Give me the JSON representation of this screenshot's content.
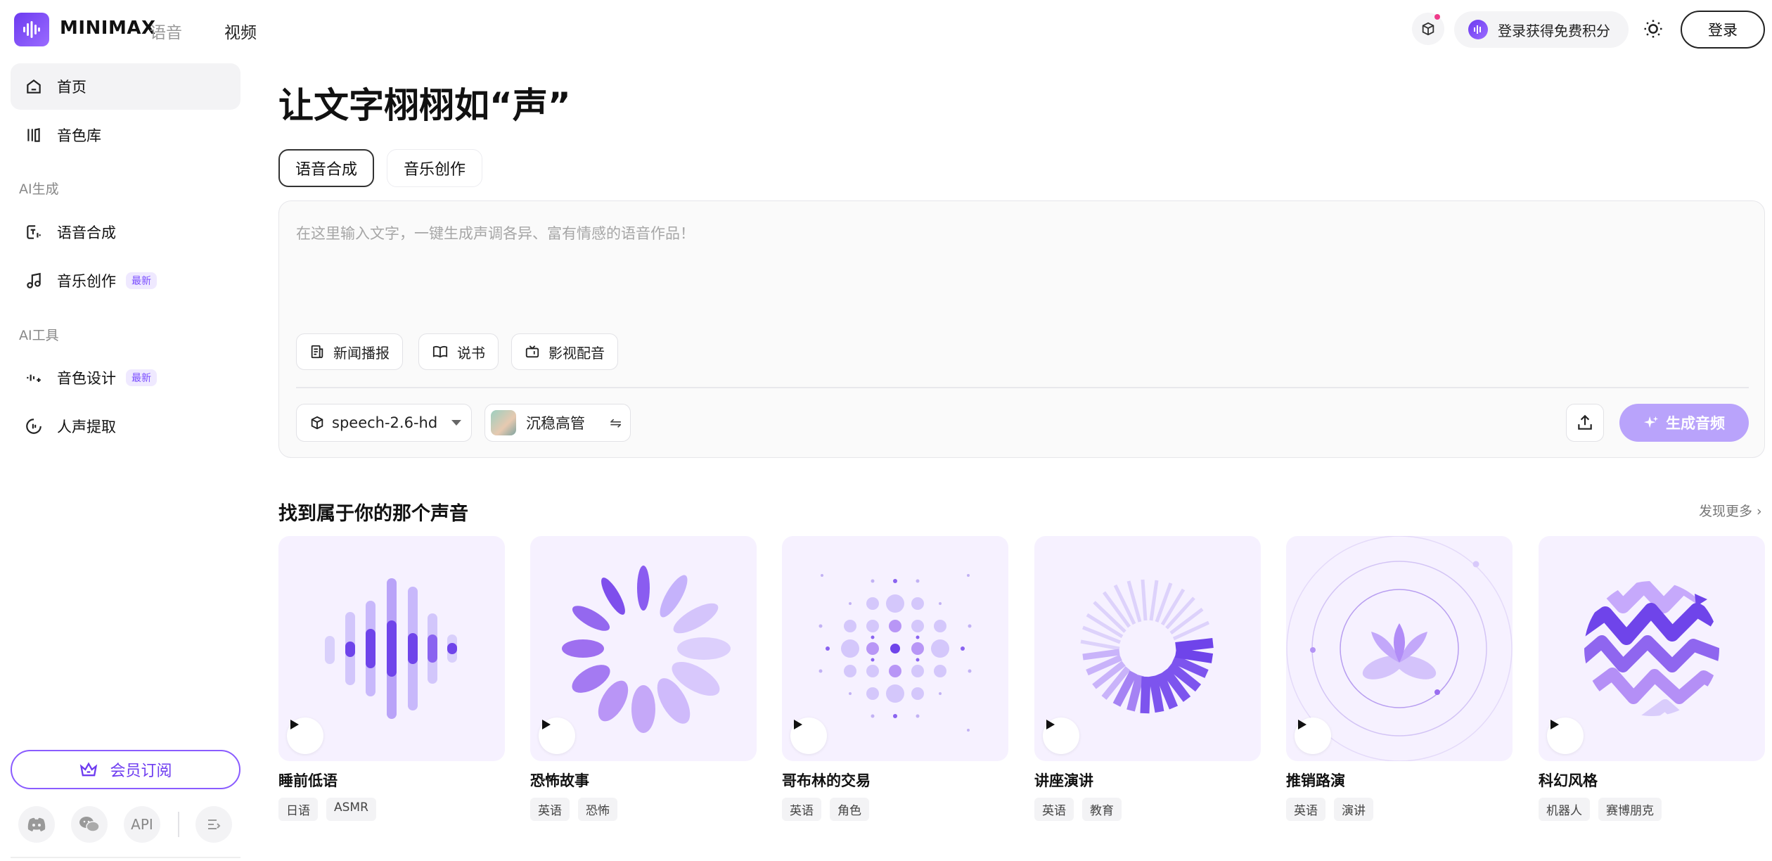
{
  "header": {
    "logo_text": "MINIMAX",
    "nav_voice": "语音",
    "nav_video": "视频",
    "points_label": "登录获得免费积分",
    "login_label": "登录"
  },
  "sidebar": {
    "items": [
      {
        "label": "首页",
        "icon": "home-icon"
      },
      {
        "label": "音色库",
        "icon": "library-icon"
      },
      {
        "label": "语音合成",
        "icon": "tts-icon"
      },
      {
        "label": "音乐创作",
        "icon": "music-note-icon",
        "badge": "最新"
      },
      {
        "label": "音色设计",
        "icon": "voice-design-icon",
        "badge": "最新"
      },
      {
        "label": "人声提取",
        "icon": "vocal-extract-icon"
      }
    ],
    "section_generate": "AI生成",
    "section_tools": "AI工具",
    "vip_label": "会员订阅",
    "footer": {
      "api_label": "API"
    }
  },
  "main": {
    "title": "让文字栩栩如“声”",
    "tabs": [
      {
        "label": "语音合成"
      },
      {
        "label": "音乐创作"
      }
    ],
    "editor": {
      "placeholder": "在这里输入文字，一键生成声调各异、富有情感的语音作品！",
      "chips": [
        {
          "label": "新闻播报",
          "icon": "news-icon"
        },
        {
          "label": "说书",
          "icon": "book-icon"
        },
        {
          "label": "影视配音",
          "icon": "tv-icon"
        }
      ],
      "model": "speech-2.6-hd",
      "voice": "沉稳高管",
      "generate_label": "生成音频"
    },
    "section_title": "找到属于你的那个声音",
    "more_label": "发现更多 ›",
    "cards": [
      {
        "name": "睡前低语",
        "tags": [
          "日语",
          "ASMR"
        ]
      },
      {
        "name": "恐怖故事",
        "tags": [
          "英语",
          "恐怖"
        ]
      },
      {
        "name": "哥布林的交易",
        "tags": [
          "英语",
          "角色"
        ]
      },
      {
        "name": "讲座演讲",
        "tags": [
          "英语",
          "教育"
        ]
      },
      {
        "name": "推销路演",
        "tags": [
          "英语",
          "演讲"
        ]
      },
      {
        "name": "科幻风格",
        "tags": [
          "机器人",
          "赛博朋克"
        ]
      }
    ]
  },
  "colors": {
    "accent": "#6d3bf0",
    "accent_light": "#b9a3fb",
    "badge_text": "#7a4dff",
    "card_bg": "#f6f1ff"
  }
}
